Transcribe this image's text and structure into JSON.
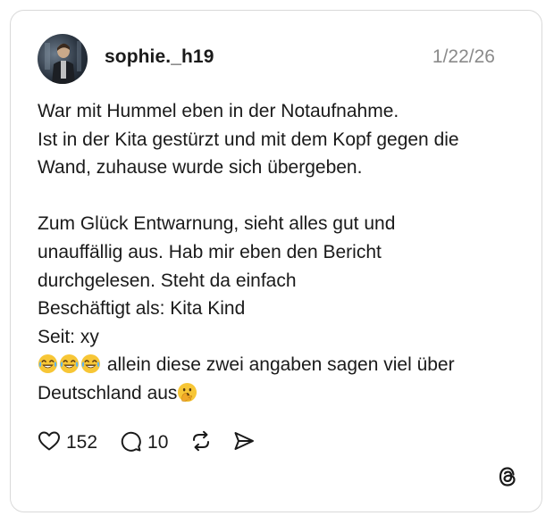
{
  "post": {
    "username": "sophie._h19",
    "date": "1/22/26",
    "lines": [
      "War mit Hummel eben in der Notaufnahme.",
      "Ist in der Kita gestürzt und mit dem Kopf gegen die",
      "Wand, zuhause wurde sich übergeben.",
      "",
      "Zum Glück Entwarnung, sieht alles gut und",
      "unauffällig aus. Hab mir eben den Bericht",
      "durchgelesen. Steht da einfach",
      "Beschäftigt als: Kita Kind",
      "Seit: xy"
    ],
    "emoji_line_text": " allein diese zwei angaben sagen viel über",
    "last_line_text": "Deutschland aus",
    "emoji_laughing": "face-with-tears-of-joy-icon",
    "emoji_end": "face-with-hand-over-mouth-icon"
  },
  "actions": {
    "likes": "152",
    "replies": "10"
  },
  "colors": {
    "text": "#1a1a1a",
    "muted": "#8a8a8a",
    "border": "#d9d9d9",
    "emoji_yellow": "#f7c636"
  }
}
